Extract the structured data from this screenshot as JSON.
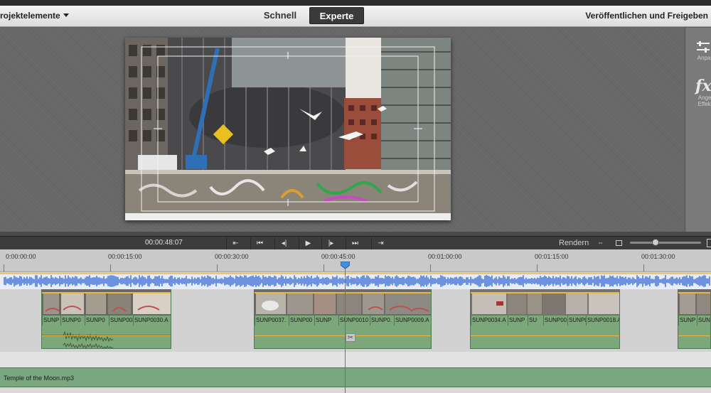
{
  "header": {
    "project_menu": "rojektelemente",
    "mode_quick": "Schnell",
    "mode_expert": "Experte",
    "publish": "Veröffentlichen und Freigeben"
  },
  "right_panel": {
    "adjust_label": "Anpass",
    "effects_label_1": "Angew",
    "effects_label_2": "Effekte",
    "adjust_icon": "sliders-icon",
    "effects_icon": "fx-icon"
  },
  "transport": {
    "timecode": "00:00:48:07",
    "render": "Rendern",
    "buttons": [
      "go-to-start",
      "previous-edit",
      "step-back",
      "play",
      "step-forward",
      "next-edit",
      "go-to-end"
    ],
    "zoom_level": 0.36
  },
  "ruler": {
    "labels": [
      "0:00:00:00",
      "00:00:15:00",
      "00:00:30:00",
      "00:00:45:00",
      "00:01:00:00",
      "00:01:15:00",
      "00:01:30:00"
    ]
  },
  "clip_labels": {
    "g1": [
      "SUNP",
      "SUNP0",
      "SUNP0",
      "SUNP0030.A"
    ],
    "g2": [
      "SUNP0037.",
      "SUNP00",
      "SUNP",
      "SUNP0010",
      "SUNP0.",
      "SUNP0009.A"
    ],
    "g3": [
      "SUNP0034.A",
      "SUNP",
      "SU",
      "SUNP00",
      "SUNP0018.A"
    ],
    "g4": [
      "SUNP"
    ]
  },
  "music": {
    "title": "Temple of the Moon.mp3"
  },
  "colors": {
    "clip_green": "#7ca77a",
    "playhead_red": "#e04040",
    "audio_blue": "#2b63d6",
    "expert_active": "#3a3a3a"
  }
}
